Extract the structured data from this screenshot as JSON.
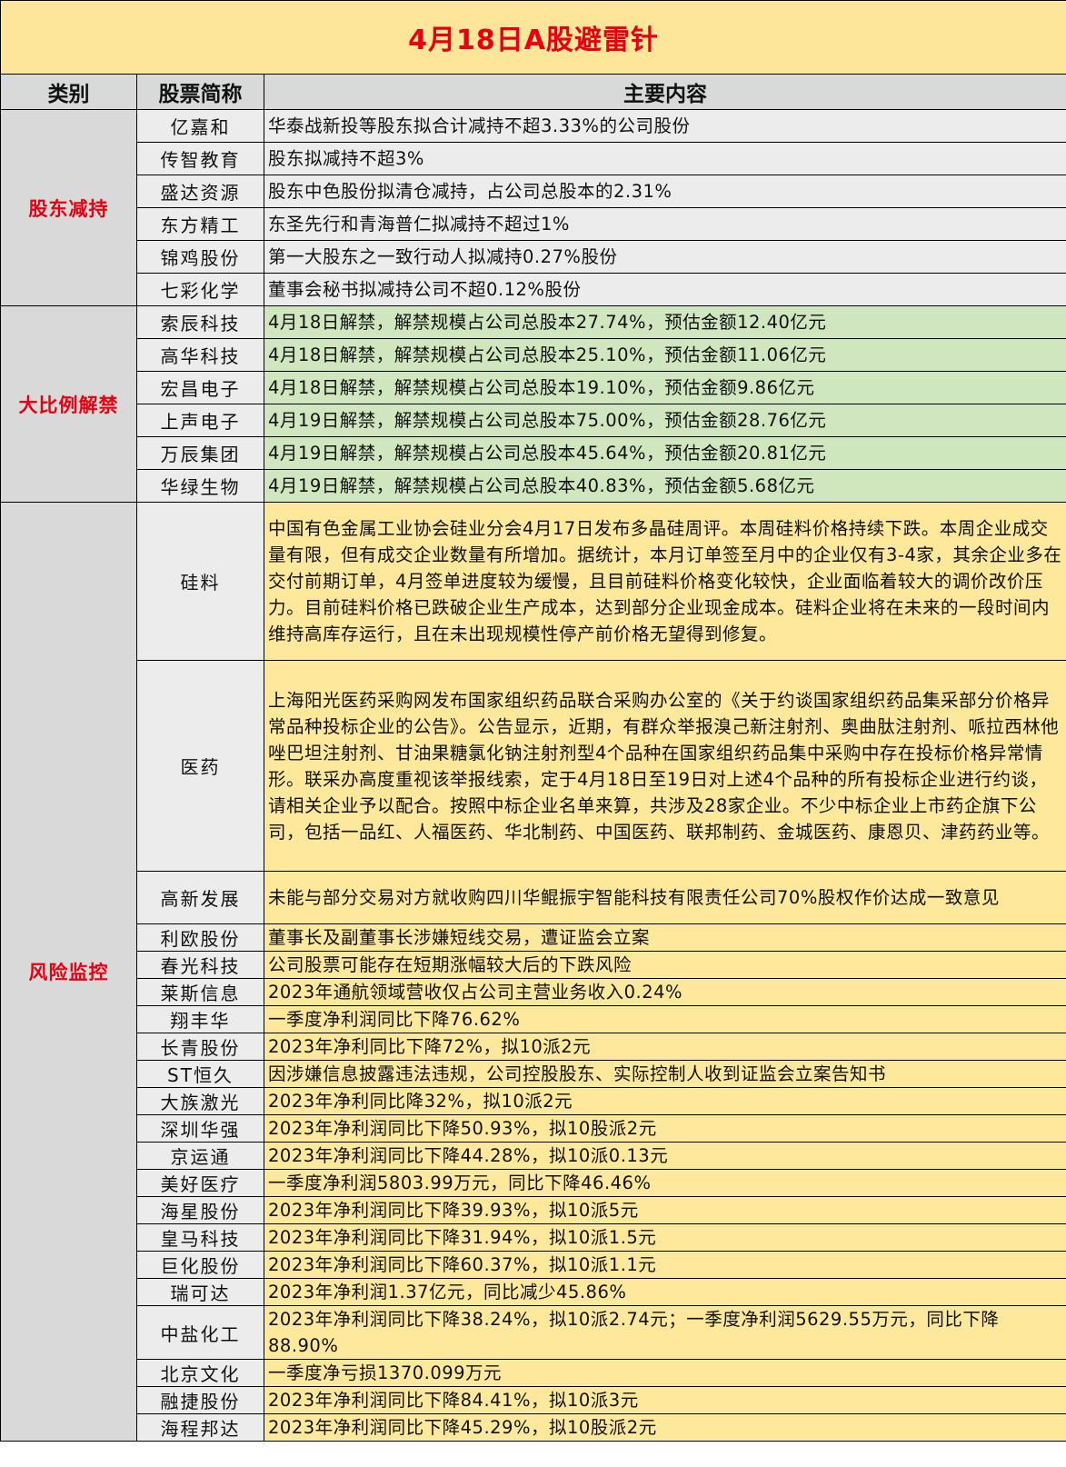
{
  "title": "4月18日A股避雷针",
  "headers": [
    "类别",
    "股票简称",
    "主要内容"
  ],
  "groups": [
    {
      "category": "股东减持",
      "theme": "g-grey",
      "rows": [
        {
          "name": "亿嘉和",
          "content": "华泰战新投等股东拟合计减持不超3.33%的公司股份"
        },
        {
          "name": "传智教育",
          "content": "股东拟减持不超3%"
        },
        {
          "name": "盛达资源",
          "content": "股东中色股份拟清仓减持，占公司总股本的2.31%"
        },
        {
          "name": "东方精工",
          "content": "东圣先行和青海普仁拟减持不超过1%"
        },
        {
          "name": "锦鸡股份",
          "content": "第一大股东之一致行动人拟减持0.27%股份"
        },
        {
          "name": "七彩化学",
          "content": "董事会秘书拟减持公司不超0.12%股份"
        }
      ]
    },
    {
      "category": "大比例解禁",
      "theme": "g-green",
      "rows": [
        {
          "name": "索辰科技",
          "content": "4月18日解禁，解禁规模占公司总股本27.74%，预估金额12.40亿元"
        },
        {
          "name": "高华科技",
          "content": "4月18日解禁，解禁规模占公司总股本25.10%，预估金额11.06亿元"
        },
        {
          "name": "宏昌电子",
          "content": "4月18日解禁，解禁规模占公司总股本19.10%，预估金额9.86亿元"
        },
        {
          "name": "上声电子",
          "content": "4月19日解禁，解禁规模占公司总股本75.00%，预估金额28.76亿元"
        },
        {
          "name": "万辰集团",
          "content": "4月19日解禁，解禁规模占公司总股本45.64%，预估金额20.81亿元"
        },
        {
          "name": "华绿生物",
          "content": "4月19日解禁，解禁规模占公司总股本40.83%，预估金额5.68亿元"
        }
      ]
    },
    {
      "category": "风险监控",
      "theme": "g-yellow",
      "rows": [
        {
          "name": "硅料",
          "content": "中国有色金属工业协会硅业分会4月17日发布多晶硅周评。本周硅料价格持续下跌。本周企业成交量有限，但有成交企业数量有所增加。据统计，本月订单签至月中的企业仅有3-4家，其余企业多在交付前期订单，4月签单进度较为缓慢，且目前硅料价格变化较快，企业面临着较大的调价改价压力。目前硅料价格已跌破企业生产成本，达到部分企业现金成本。硅料企业将在未来的一段时间内维持高库存运行，且在未出现规模性停产前价格无望得到修复。"
        },
        {
          "name": "医药",
          "content": "上海阳光医药采购网发布国家组织药品联合采购办公室的《关于约谈国家组织药品集采部分价格异常品种投标企业的公告》。公告显示，近期，有群众举报溴己新注射剂、奥曲肽注射剂、哌拉西林他唑巴坦注射剂、甘油果糖氯化钠注射剂型4个品种在国家组织药品集中采购中存在投标价格异常情形。联采办高度重视该举报线索，定于4月18日至19日对上述4个品种的所有投标企业进行约谈，请相关企业予以配合。按照中标企业名单来算，共涉及28家企业。不少中标企业上市药企旗下公司，包括一品红、人福医药、华北制药、中国医药、联邦制药、金城医药、康恩贝、津药药业等。"
        },
        {
          "name": "高新发展",
          "content": "未能与部分交易对方就收购四川华鲲振宇智能科技有限责任公司70%股权作价达成一致意见"
        },
        {
          "name": "利欧股份",
          "content": "董事长及副董事长涉嫌短线交易，遭证监会立案"
        },
        {
          "name": "春光科技",
          "content": "公司股票可能存在短期涨幅较大后的下跌风险"
        },
        {
          "name": "莱斯信息",
          "content": "2023年通航领域营收仅占公司主营业务收入0.24%"
        },
        {
          "name": "翔丰华",
          "content": "一季度净利润同比下降76.62%"
        },
        {
          "name": "长青股份",
          "content": "2023年净利同比下降72%，拟10派2元"
        },
        {
          "name": "ST恒久",
          "content": "因涉嫌信息披露违法违规，公司控股股东、实际控制人收到证监会立案告知书"
        },
        {
          "name": "大族激光",
          "content": "2023年净利同比降32%，拟10派2元"
        },
        {
          "name": "深圳华强",
          "content": "2023年净利润同比下降50.93%，拟10股派2元"
        },
        {
          "name": "京运通",
          "content": "2023年净利润同比下降44.28%，拟10派0.13元"
        },
        {
          "name": "美好医疗",
          "content": "一季度净利润5803.99万元，同比下降46.46%"
        },
        {
          "name": "海星股份",
          "content": "2023年净利润同比下降39.93%，拟10派5元"
        },
        {
          "name": "皇马科技",
          "content": "2023年净利润同比下降31.94%，拟10派1.5元"
        },
        {
          "name": "巨化股份",
          "content": "2023年净利润同比下降60.37%，拟10派1.1元"
        },
        {
          "name": "瑞可达",
          "content": "2023年净利润1.37亿元，同比减少45.86%"
        },
        {
          "name": "中盐化工",
          "content": "2023年净利润同比下降38.24%，拟10派2.74元；一季度净利润5629.55万元，同比下降88.90%"
        },
        {
          "name": "北京文化",
          "content": "一季度净亏损1370.099万元"
        },
        {
          "name": "融捷股份",
          "content": "2023年净利润同比下降84.41%，拟10派3元"
        },
        {
          "name": "海程邦达",
          "content": "2023年净利润同比下降45.29%，拟10股派2元"
        }
      ]
    }
  ]
}
